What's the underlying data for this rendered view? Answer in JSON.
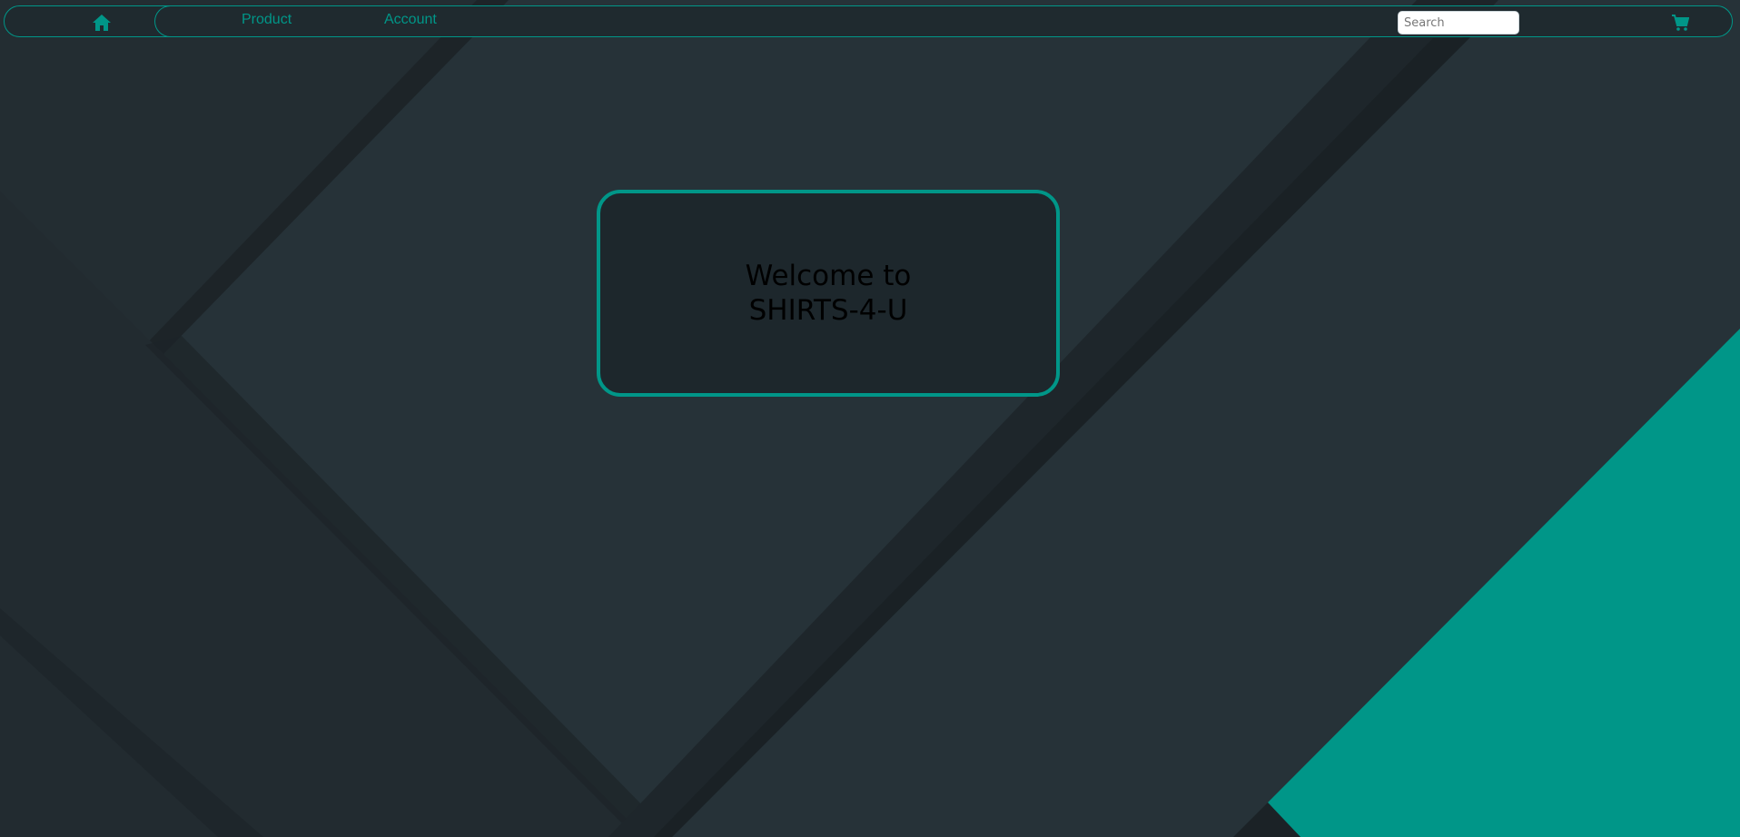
{
  "colors": {
    "accent": "#009688",
    "background": "#263238",
    "navbar_bg": "#1f2a2f",
    "card_bg": "#1d272c",
    "title_text": "#000000"
  },
  "navbar": {
    "home_icon": "home-icon",
    "links": [
      {
        "label": "Product"
      },
      {
        "label": "Account"
      }
    ],
    "search": {
      "value": "",
      "placeholder": "Search"
    },
    "cart_icon": "shopping-cart-icon"
  },
  "welcome": {
    "line1": "Welcome to",
    "line2": "SHIRTS-4-U"
  }
}
